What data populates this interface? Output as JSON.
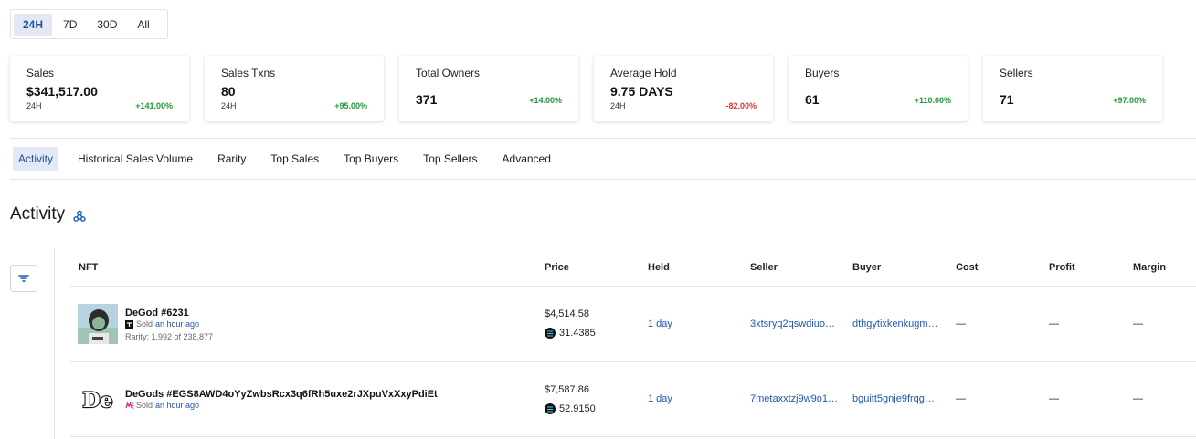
{
  "range": {
    "options": [
      "24H",
      "7D",
      "30D",
      "All"
    ],
    "active": "24H"
  },
  "stats": [
    {
      "label": "Sales",
      "value": "$341,517.00",
      "period": "24H",
      "change": "+141.00%",
      "trend": "positive"
    },
    {
      "label": "Sales Txns",
      "value": "80",
      "period": "24H",
      "change": "+95.00%",
      "trend": "positive"
    },
    {
      "label": "Total Owners",
      "value": "371",
      "period": "",
      "change": "+14.00%",
      "trend": "positive"
    },
    {
      "label": "Average Hold",
      "value": "9.75 DAYS",
      "period": "24H",
      "change": "-82.00%",
      "trend": "negative"
    },
    {
      "label": "Buyers",
      "value": "61",
      "period": "",
      "change": "+110.00%",
      "trend": "positive"
    },
    {
      "label": "Sellers",
      "value": "71",
      "period": "",
      "change": "+97.00%",
      "trend": "positive"
    }
  ],
  "tabs": [
    "Activity",
    "Historical Sales Volume",
    "Rarity",
    "Top Sales",
    "Top Buyers",
    "Top Sellers",
    "Advanced"
  ],
  "active_tab": "Activity",
  "section": {
    "title": "Activity"
  },
  "table": {
    "headers": {
      "nft": "NFT",
      "price": "Price",
      "held": "Held",
      "seller": "Seller",
      "buyer": "Buyer",
      "cost": "Cost",
      "profit": "Profit",
      "margin": "Margin"
    },
    "rows": [
      {
        "name": "DeGod #6231",
        "sold_label": "Sold",
        "sold_ago": "an hour ago",
        "rarity": "Rarity: 1,992 of 238,877",
        "price_usd": "$4,514.58",
        "price_sol": "31.4385",
        "held": "1 day",
        "seller": "3xtsryq2qswdiuo…",
        "buyer": "dthgytixkenkugm…",
        "cost": "—",
        "profit": "—",
        "margin": "—",
        "marketplace_icon": "tensor-icon"
      },
      {
        "name": "DeGods #EGS8AWD4oYyZwbsRcx3q6fRh5uxe2rJXpuVxXxyPdiEt",
        "sold_label": "Sold",
        "sold_ago": "an hour ago",
        "rarity": "",
        "price_usd": "$7,587.86",
        "price_sol": "52.9150",
        "held": "1 day",
        "seller": "7metaxxtzj9w9o1…",
        "buyer": "bguitt5gnje9frqg…",
        "cost": "—",
        "profit": "—",
        "margin": "—",
        "marketplace_icon": "magic-eden-icon",
        "logo_text": "De"
      }
    ]
  },
  "colors": {
    "accent": "#1e4f9a",
    "positive": "#21963a",
    "negative": "#d93838",
    "link": "#2056b3"
  }
}
